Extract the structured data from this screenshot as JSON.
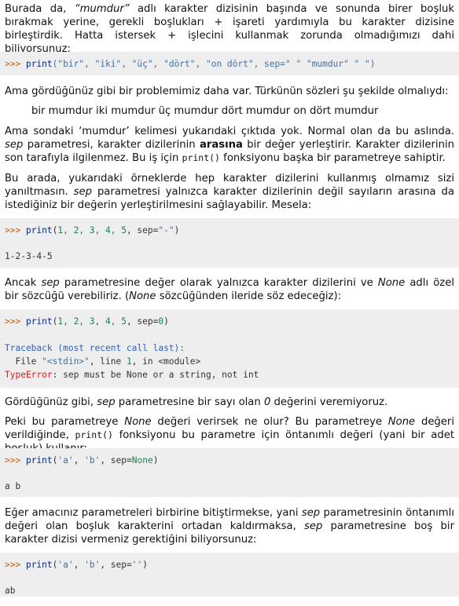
{
  "p1": {
    "a": "Burada da, ",
    "a_it": "“mumdur”",
    "b": " adlı karakter dizisinin başında ve sonunda birer boşluk bırakmak yerine, gerekli boşlukları ",
    "b_it": "+",
    "c": " işareti yardımıyla bu karakter dizisine birleştirdik. Hatta istersek ",
    "c_it": "+",
    "d": " işlecini kullanmak zorunda olmadığımızı dahi biliyorsunuz:"
  },
  "code1": {
    "prompt": ">>> ",
    "fn": "print",
    "args": "(\"bir\", \"iki\", \"üç\", \"dört\", \"on dört\", sep=\" \" \"mumdur\" \" \")"
  },
  "p2": "Ama gördüğünüz gibi bir problemimiz daha var. Türkünün sözleri şu şekilde olmalıydı:",
  "p2_quote": "bir mumdur iki mumdur üç mumdur dört mumdur on dört mumdur",
  "p3": {
    "a": "Ama sondaki ‘mumdur’ kelimesi yukarıdaki çıktıda yok. Normal olan da bu aslında. ",
    "a_it": "sep",
    "b": " parametresi, karakter dizilerinin ",
    "b_bold": "arasına",
    "c": " bir değer yerleştirir. Karakter dizilerinin son tarafıyla ilgilenmez. Bu iş için ",
    "c_mono": "print()",
    "d": " fonksiyonu başka bir parametreye sahiptir."
  },
  "p4": {
    "a": "Bu arada, yukarıdaki örneklerde hep karakter dizilerini kullanmış olmamız sizi yanıltmasın. ",
    "a_it": "sep",
    "b": " parametresi yalnızca karakter dizilerinin değil sayıların arasına da istediğiniz bir değerin yerleştirilmesini sağlayabilir. Mesela:"
  },
  "code2": {
    "prompt": ">>> ",
    "fn": "print",
    "args_pre": "(",
    "nums": "1, 2, 3, 4, 5",
    "args_sep": ", sep=",
    "args_str": "\"-\"",
    "args_end": ")",
    "output": "1-2-3-4-5"
  },
  "p5": {
    "a": "Ancak ",
    "a_it": "sep",
    "b": " parametresine değer olarak yalnızca karakter dizilerini ve ",
    "b_it": "None",
    "c": " adlı özel bir sözcüğü verebiliriz. (",
    "c_it": "None",
    "d": " sözcüğünden ileride söz edeceğiz):"
  },
  "code3": {
    "prompt": ">>> ",
    "fn": "print",
    "args_pre": "(",
    "nums": "1, 2, 3, 4, 5",
    "args_sep": ", sep=",
    "args_val": "0",
    "args_end": ")",
    "tb1": "Traceback (most recent call last):",
    "tb2_a": "  File ",
    "tb2_str": "\"<stdin>\"",
    "tb2_b": ", line ",
    "tb2_num": "1",
    "tb2_c": ", in <module>",
    "err_name": "TypeError",
    "err_msg": ": sep must be None or a string, not int"
  },
  "p6": {
    "a": "Gördüğünüz gibi, ",
    "a_it": "sep",
    "b": " parametresine bir sayı olan ",
    "b_it": "0",
    "c": " değerini veremiyoruz."
  },
  "p7": {
    "a": "Peki bu parametreye ",
    "a_it": "None",
    "b": " değeri verirsek ne olur? Bu parametreye ",
    "b_it": "None",
    "c": " değeri verildiğinde, ",
    "c_mono": "print()",
    "d": " fonksiyonu bu parametre için öntanımlı değeri (yani bir adet boşluk) kullanır:"
  },
  "code4": {
    "prompt": ">>> ",
    "fn": "print",
    "args_pre": "(",
    "s1": "'a'",
    "comma": ", ",
    "s2": "'b'",
    "args_sep": ", sep=",
    "kwval": "None",
    "args_end": ")",
    "output": "a b"
  },
  "p8": {
    "a": "Eğer amacınız parametreleri birbirine bitiştirmekse, yani ",
    "a_it": "sep",
    "b": " parametresinin öntanımlı değeri olan boşluk karakterini ortadan kaldırmaksa, ",
    "b_it": "sep",
    "c": " parametresine boş bir karakter dizisi vermeniz gerektiğini biliyorsunuz:"
  },
  "code5": {
    "prompt": ">>> ",
    "fn": "print",
    "args_pre": "(",
    "s1": "'a'",
    "comma": ", ",
    "s2": "'b'",
    "args_sep": ", sep=",
    "s3": "''",
    "args_end": ")",
    "output": "ab"
  },
  "colors": {
    "code_bg": "#eeeeee",
    "prompt": "#c65d09",
    "keyword": "#06287e",
    "string": "#4070a0",
    "number": "#208050",
    "traceback": "#2a62c8",
    "error": "#d02020"
  }
}
